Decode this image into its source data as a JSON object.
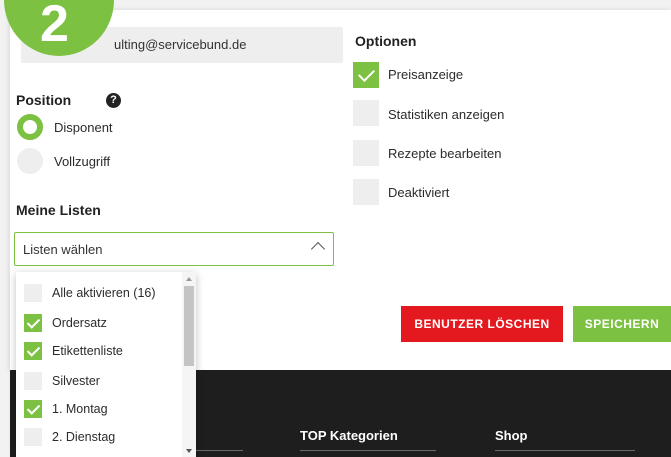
{
  "badge": {
    "number": "2"
  },
  "email": {
    "value": "ulting@servicebund.de"
  },
  "position": {
    "heading": "Position",
    "options": [
      {
        "label": "Disponent",
        "selected": true
      },
      {
        "label": "Vollzugriff",
        "selected": false
      }
    ]
  },
  "lists": {
    "heading": "Meine Listen",
    "select_value": "Listen wählen",
    "items": [
      {
        "label": "Alle aktivieren (16)",
        "checked": false
      },
      {
        "label": "Ordersatz",
        "checked": true
      },
      {
        "label": "Etikettenliste",
        "checked": true
      },
      {
        "label": "Silvester",
        "checked": false
      },
      {
        "label": "1. Montag",
        "checked": true
      },
      {
        "label": "2. Dienstag",
        "checked": false
      }
    ]
  },
  "options": {
    "heading": "Optionen",
    "items": [
      {
        "label": "Preisanzeige",
        "checked": true
      },
      {
        "label": "Statistiken anzeigen",
        "checked": false
      },
      {
        "label": "Rezepte bearbeiten",
        "checked": false
      },
      {
        "label": "Deaktiviert",
        "checked": false
      }
    ]
  },
  "buttons": {
    "delete_label": "BENUTZER LÖSCHEN",
    "save_label": "SPEICHERN"
  },
  "footer": {
    "col1": "TOP Kategorien",
    "col2": "Shop"
  },
  "colors": {
    "accent": "#7cc142",
    "danger": "#e3191f",
    "footer_bg": "#1e1e1e"
  },
  "icons": {
    "help": "question-circle-icon",
    "chevron": "chevron-up-icon"
  }
}
